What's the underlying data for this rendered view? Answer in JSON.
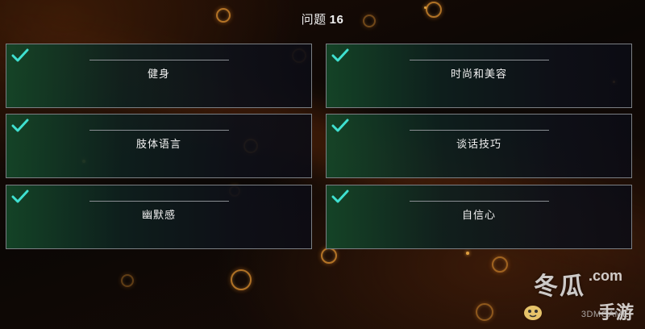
{
  "question": {
    "prefix": "问题",
    "number": "16"
  },
  "options": [
    {
      "label": "健身",
      "checked": true
    },
    {
      "label": "时尚和美容",
      "checked": true
    },
    {
      "label": "肢体语言",
      "checked": true
    },
    {
      "label": "谈话技巧",
      "checked": true
    },
    {
      "label": "幽默感",
      "checked": true
    },
    {
      "label": "自信心",
      "checked": true
    }
  ],
  "watermark": {
    "brand": "冬瓜",
    "dotcom": ".com",
    "sub": "手游",
    "site": "3DMGAME"
  },
  "colors": {
    "check": "#3fe0d0",
    "card_border": "#7b7f84",
    "card_green": "#144628"
  },
  "icons": {
    "check": "checkmark-icon"
  }
}
